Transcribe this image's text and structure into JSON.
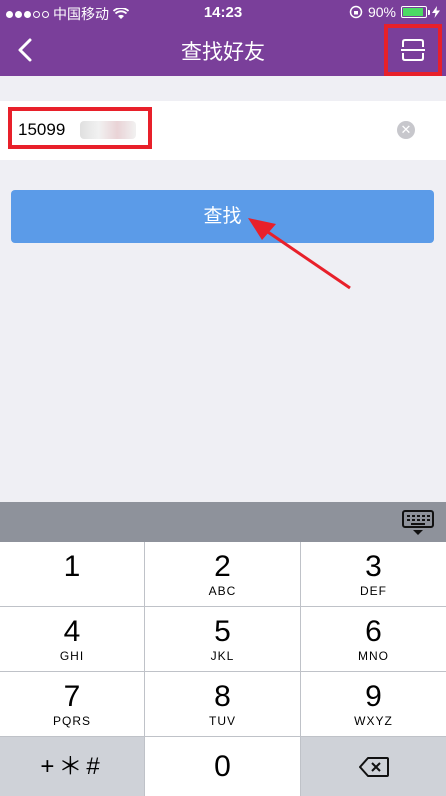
{
  "status_bar": {
    "carrier": "中国移动",
    "time": "14:23",
    "battery": "90%",
    "battery_level": 0.9
  },
  "nav": {
    "title": "查找好友"
  },
  "search": {
    "value": "15099"
  },
  "find_button": {
    "label": "查找"
  },
  "keypad": {
    "keys": [
      {
        "num": "1",
        "letters": ""
      },
      {
        "num": "2",
        "letters": "ABC"
      },
      {
        "num": "3",
        "letters": "DEF"
      },
      {
        "num": "4",
        "letters": "GHI"
      },
      {
        "num": "5",
        "letters": "JKL"
      },
      {
        "num": "6",
        "letters": "MNO"
      },
      {
        "num": "7",
        "letters": "PQRS"
      },
      {
        "num": "8",
        "letters": "TUV"
      },
      {
        "num": "9",
        "letters": "WXYZ"
      }
    ],
    "symbols": "+＊#",
    "zero": "0"
  },
  "colors": {
    "nav": "#7a3f9a",
    "button": "#5b9be8",
    "highlight": "#e8202a"
  }
}
